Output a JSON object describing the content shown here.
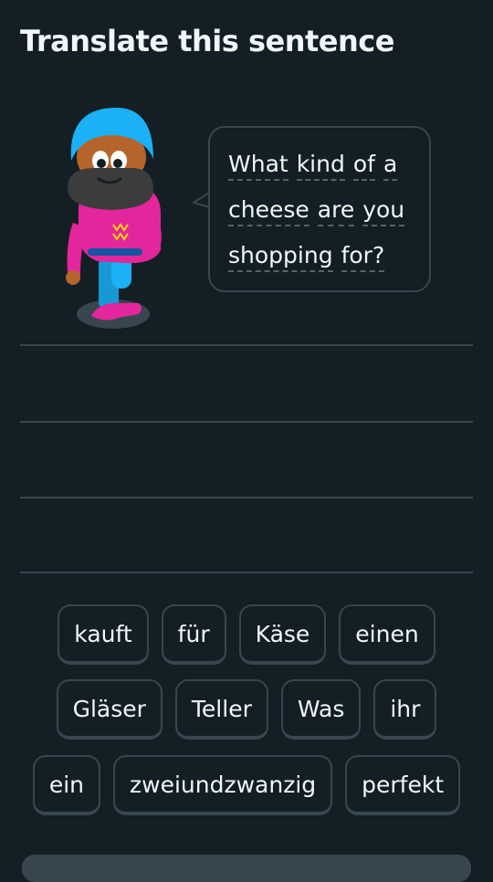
{
  "header": {
    "title": "Translate this sentence"
  },
  "character": {
    "icon": "duo-character-turban-icon"
  },
  "prompt": {
    "lines": [
      [
        "What",
        "kind",
        "of",
        "a"
      ],
      [
        "cheese",
        "are",
        "you"
      ],
      [
        "shopping",
        "for?"
      ]
    ]
  },
  "word_bank": {
    "rows": [
      [
        "kauft",
        "für",
        "Käse",
        "einen"
      ],
      [
        "Gläser",
        "Teller",
        "Was",
        "ihr"
      ],
      [
        "ein",
        "zweiundzwanzig",
        "perfekt"
      ]
    ]
  },
  "colors": {
    "background": "#131f24",
    "border": "#37464f",
    "text": "#f1f7fb",
    "turban": "#1cb0f6",
    "sweater": "#e3269b",
    "beard": "#3c3c3c"
  }
}
